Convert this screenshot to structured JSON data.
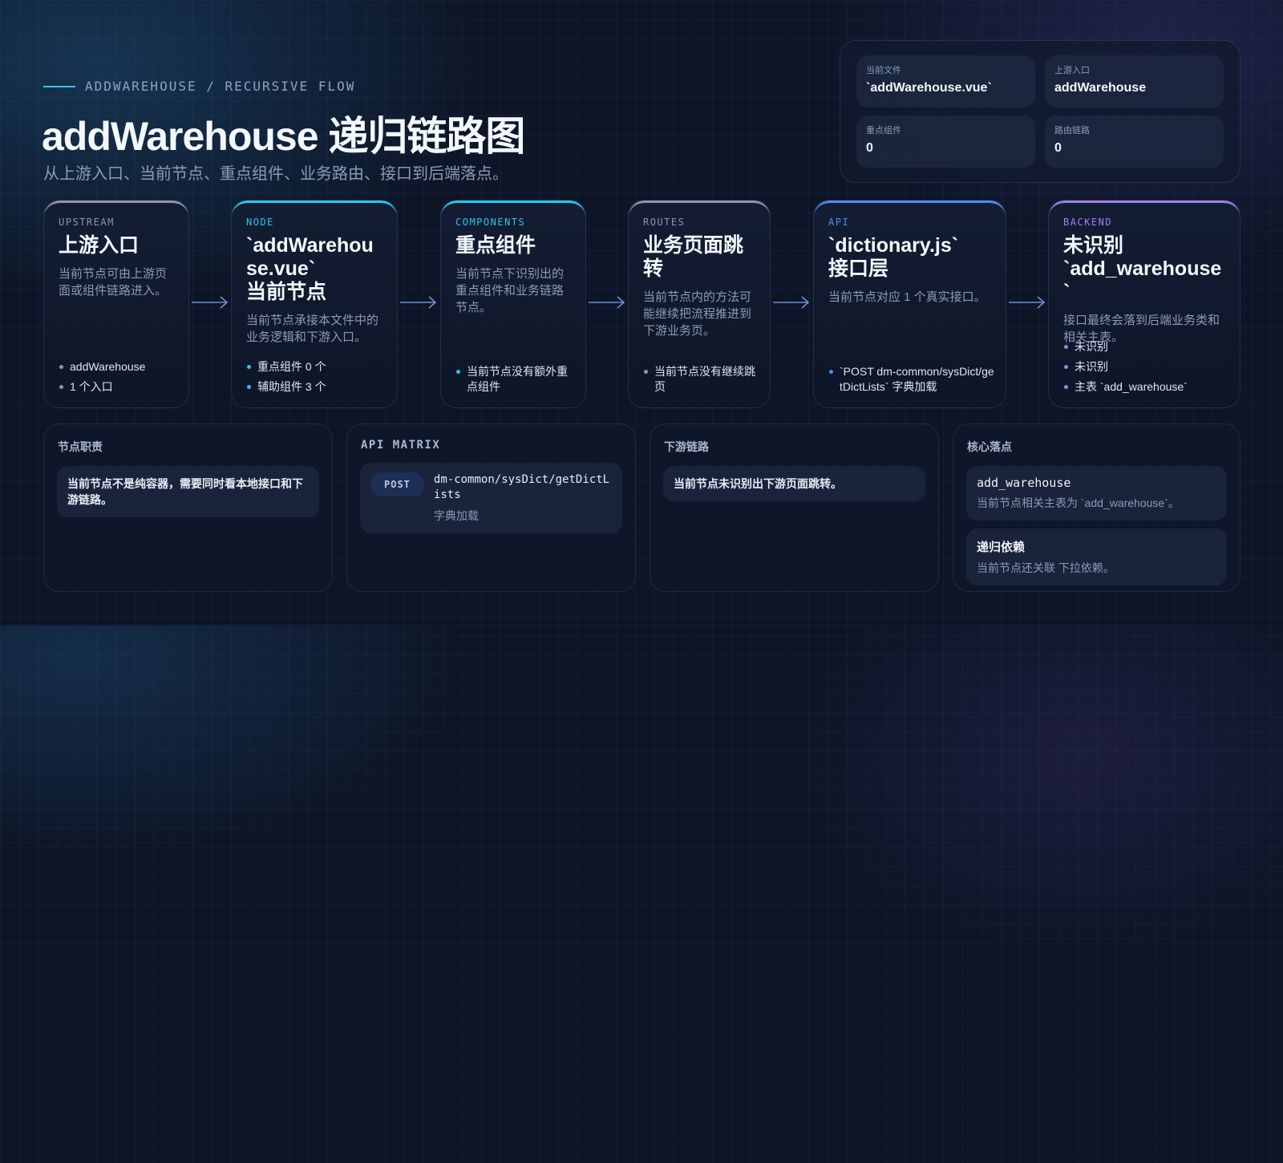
{
  "header": {
    "eyebrow": "ADDWAREHOUSE / RECURSIVE FLOW",
    "title": "addWarehouse 递归链路图",
    "subtitle": "从上游入口、当前节点、重点组件、业务路由、接口到后端落点。"
  },
  "stats": [
    {
      "label": "当前文件",
      "value": "`addWarehouse.vue`"
    },
    {
      "label": "上游入口",
      "value": "addWarehouse"
    },
    {
      "label": "重点组件",
      "value": "0"
    },
    {
      "label": "路由链路",
      "value": "0"
    }
  ],
  "flow": [
    {
      "tag": "UPSTREAM",
      "title": "上游入口",
      "desc": "当前节点可由上游页面或组件链路进入。",
      "items": [
        "addWarehouse",
        "1 个入口"
      ]
    },
    {
      "tag": "NODE",
      "title": "`addWarehouse.vue`\n当前节点",
      "desc": "当前节点承接本文件中的业务逻辑和下游入口。",
      "items": [
        "重点组件 0 个",
        "辅助组件 3 个"
      ]
    },
    {
      "tag": "COMPONENTS",
      "title": "重点组件",
      "desc": "当前节点下识别出的重点组件和业务链路节点。",
      "items": [
        "当前节点没有额外重点组件"
      ]
    },
    {
      "tag": "ROUTES",
      "title": "业务页面跳转",
      "desc": "当前节点内的方法可能继续把流程推进到下游业务页。",
      "items": [
        "当前节点没有继续跳页"
      ]
    },
    {
      "tag": "API",
      "title": "`dictionary.js`\n接口层",
      "desc": "当前节点对应 1 个真实接口。",
      "items": [
        "`POST dm-common/sysDict/getDictLists` 字典加载"
      ]
    },
    {
      "tag": "BACKEND",
      "title": "未识别\n`add_warehouse`",
      "desc": "接口最终会落到后端业务类和相关主表。",
      "items": [
        "未识别",
        "未识别",
        "主表 `add_warehouse`"
      ]
    }
  ],
  "panels": {
    "duty": {
      "title": "节点职责",
      "text": "当前节点不是纯容器，需要同时看本地接口和下游链路。"
    },
    "api": {
      "title": "API MATRIX",
      "method": "POST",
      "path": "dm-common/sysDict/getDictLists",
      "desc": "字典加载"
    },
    "downstream": {
      "title": "下游链路",
      "text": "当前节点未识别出下游页面跳转。"
    },
    "core": {
      "title": "核心落点",
      "items": [
        {
          "title": "add_warehouse",
          "desc": "当前节点相关主表为 `add_warehouse`。"
        },
        {
          "title": "递归依赖",
          "desc": "当前节点还关联 下拉依赖。"
        }
      ]
    }
  },
  "colors": {
    "upstream": "#8c97a8",
    "node": "#2ec6e8",
    "components": "#2ec6e8",
    "routes": "#8c97a8",
    "api": "#4f8df5",
    "backend": "#a07ef0"
  }
}
